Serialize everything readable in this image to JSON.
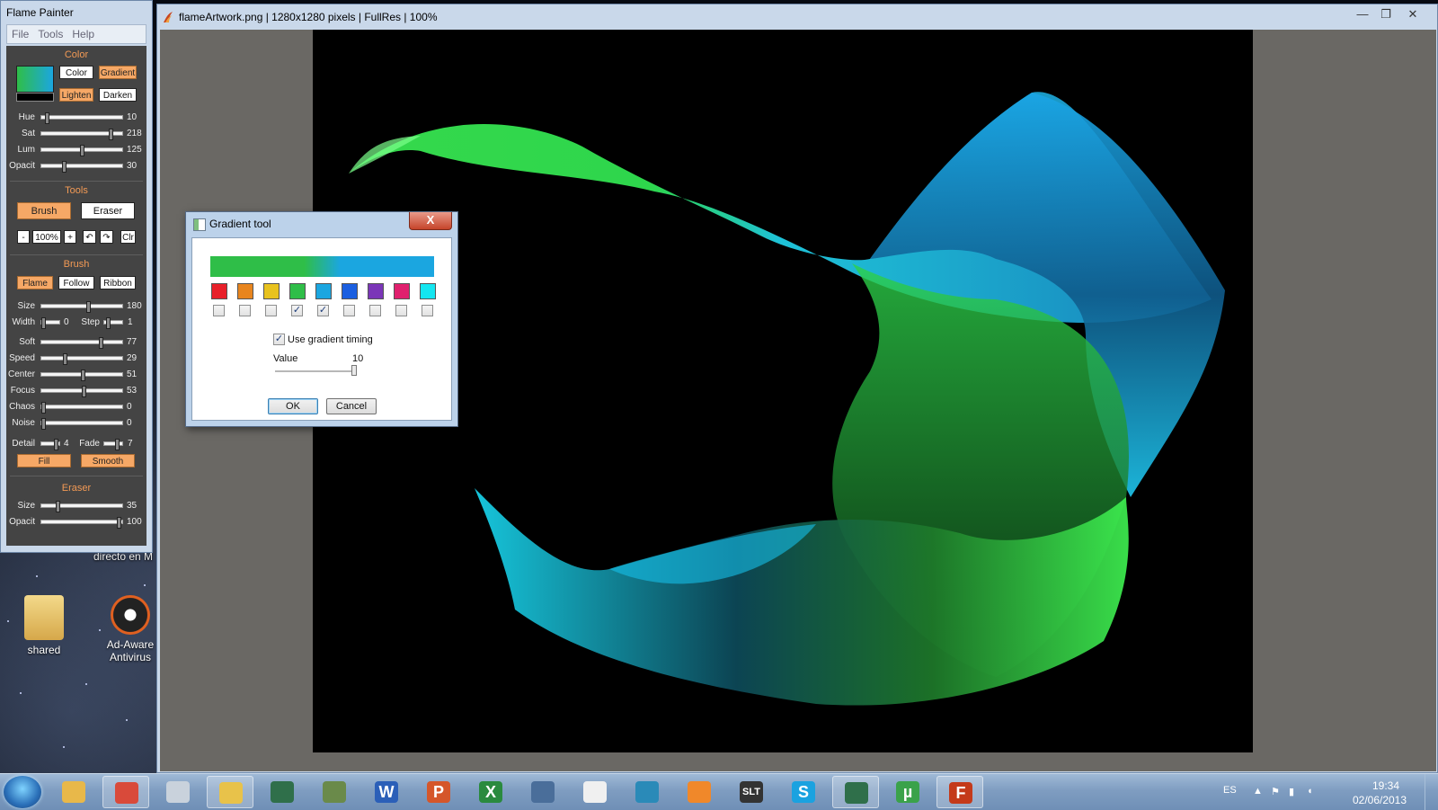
{
  "panel": {
    "title": "Flame Painter",
    "menu": [
      "File",
      "Tools",
      "Help"
    ],
    "color": {
      "section": "Color",
      "color_btn": "Color",
      "gradient_btn": "Gradient",
      "lighten_btn": "Lighten",
      "darken_btn": "Darken",
      "sliders": [
        {
          "label": "Hue",
          "value": "10",
          "pos": 0.05
        },
        {
          "label": "Sat",
          "value": "218",
          "pos": 0.86
        },
        {
          "label": "Lum",
          "value": "125",
          "pos": 0.49
        },
        {
          "label": "Opacit",
          "value": "30",
          "pos": 0.27
        }
      ]
    },
    "tools": {
      "section": "Tools",
      "brush_btn": "Brush",
      "eraser_btn": "Eraser",
      "minus": "-",
      "zoom": "100%",
      "plus": "+",
      "undo_icon": "undo-icon",
      "redo_icon": "redo-icon",
      "clear_btn": "Clr"
    },
    "brush": {
      "section": "Brush",
      "flame_btn": "Flame",
      "follow_btn": "Follow",
      "ribbon_btn": "Ribbon",
      "size": {
        "label": "Size",
        "value": "180",
        "pos": 0.58
      },
      "width": {
        "label": "Width",
        "value": "0",
        "pos": 0.02
      },
      "step": {
        "label": "Step",
        "value": "1",
        "pos": 0.1
      },
      "sliders": [
        {
          "label": "Soft",
          "value": "77",
          "pos": 0.73
        },
        {
          "label": "Speed",
          "value": "29",
          "pos": 0.28
        },
        {
          "label": "Center",
          "value": "51",
          "pos": 0.5
        },
        {
          "label": "Focus",
          "value": "53",
          "pos": 0.52
        },
        {
          "label": "Chaos",
          "value": "0",
          "pos": 0.0
        },
        {
          "label": "Noise",
          "value": "0",
          "pos": 0.0
        }
      ],
      "detail": {
        "label": "Detail",
        "value": "4",
        "pos": 0.8
      },
      "fade": {
        "label": "Fade",
        "value": "7",
        "pos": 0.7
      },
      "fill_btn": "Fill",
      "smooth_btn": "Smooth"
    },
    "eraser": {
      "section": "Eraser",
      "sliders": [
        {
          "label": "Size",
          "value": "35",
          "pos": 0.18
        },
        {
          "label": "Opacit",
          "value": "100",
          "pos": 0.97
        }
      ]
    }
  },
  "viewer": {
    "title": "flameArtwork.png | 1280x1280 pixels | FullRes | 100%",
    "minimize": "—",
    "maximize": "❐",
    "close": "✕"
  },
  "dialog": {
    "title": "Gradient tool",
    "close": "X",
    "swatches": [
      {
        "color": "#e8202a",
        "checked": false
      },
      {
        "color": "#e8851e",
        "checked": false
      },
      {
        "color": "#e8c21e",
        "checked": false
      },
      {
        "color": "#2fbe48",
        "checked": true
      },
      {
        "color": "#1ba6e0",
        "checked": true
      },
      {
        "color": "#1b5fe0",
        "checked": false
      },
      {
        "color": "#7b36b8",
        "checked": false
      },
      {
        "color": "#e0206e",
        "checked": false
      },
      {
        "color": "#14e6f0",
        "checked": false
      }
    ],
    "use_timing_label": "Use gradient timing",
    "use_timing_checked": true,
    "value_label": "Value",
    "value": "10",
    "ok": "OK",
    "cancel": "Cancel"
  },
  "desktop": {
    "icons": [
      {
        "label": "shared",
        "icon": "folder-icon"
      },
      {
        "label": "Ad-Aware Antivirus",
        "icon": "ad-aware-icon"
      }
    ],
    "partial_text": "directo en M"
  },
  "taskbar": {
    "apps": [
      {
        "name": "explorer",
        "icon": "folder-icon",
        "color": "#e8b84a",
        "glyph": ""
      },
      {
        "name": "chrome",
        "icon": "chrome-icon",
        "color": "#d94a3a",
        "glyph": ""
      },
      {
        "name": "calculator",
        "icon": "calculator-icon",
        "color": "#c9d2dc",
        "glyph": ""
      },
      {
        "name": "paint",
        "icon": "paint-icon",
        "color": "#e8c24a",
        "glyph": ""
      },
      {
        "name": "monitor",
        "icon": "monitor-icon",
        "color": "#2f6f4a",
        "glyph": ""
      },
      {
        "name": "joystick",
        "icon": "joystick-icon",
        "color": "#6a8a4a",
        "glyph": ""
      },
      {
        "name": "word",
        "icon": "word-icon",
        "color": "#2b5fb8",
        "glyph": "W"
      },
      {
        "name": "powerpoint",
        "icon": "powerpoint-icon",
        "color": "#d5562a",
        "glyph": "P"
      },
      {
        "name": "excel",
        "icon": "excel-icon",
        "color": "#2a8a3e",
        "glyph": "X"
      },
      {
        "name": "virtualbox",
        "icon": "virtualbox-icon",
        "color": "#4a6e9a",
        "glyph": ""
      },
      {
        "name": "calendar",
        "icon": "calendar-icon",
        "color": "#f0f0f0",
        "glyph": ""
      },
      {
        "name": "search",
        "icon": "magnifier-icon",
        "color": "#2a8ab8",
        "glyph": ""
      },
      {
        "name": "sublime",
        "icon": "sublime-icon",
        "color": "#f0882a",
        "glyph": ""
      },
      {
        "name": "slt",
        "icon": "slt-icon",
        "color": "#333333",
        "glyph": "SLT"
      },
      {
        "name": "skype",
        "icon": "skype-icon",
        "color": "#1aa2e0",
        "glyph": "S"
      },
      {
        "name": "monitor2",
        "icon": "monitor-icon",
        "color": "#2f6f4a",
        "glyph": ""
      },
      {
        "name": "utorrent",
        "icon": "utorrent-icon",
        "color": "#3aa24a",
        "glyph": "µ"
      },
      {
        "name": "flame-painter",
        "icon": "flame-painter-icon",
        "color": "#c43a1a",
        "glyph": "F"
      }
    ],
    "lang": "ES",
    "time": "19:34",
    "date": "02/06/2013"
  }
}
